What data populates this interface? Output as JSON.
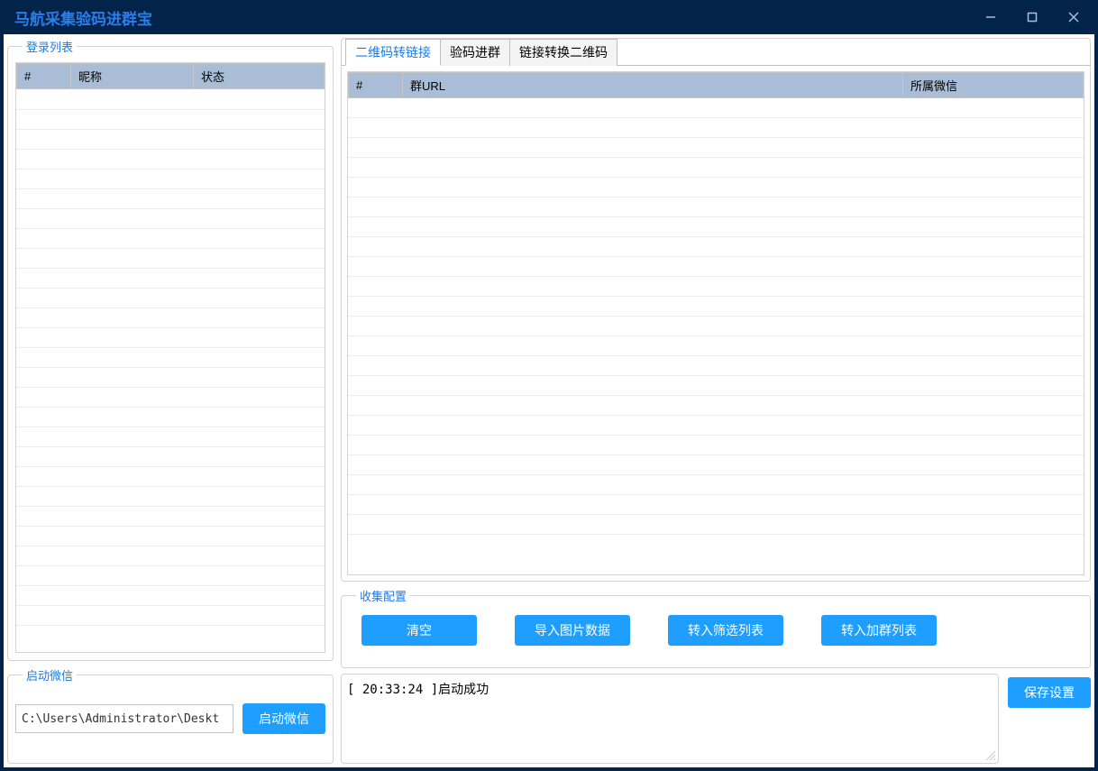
{
  "window": {
    "title": "马航采集验码进群宝"
  },
  "left": {
    "login_list_title": "登录列表",
    "login_cols": {
      "num": "#",
      "nick": "昵称",
      "status": "状态"
    },
    "start_wechat_title": "启动微信",
    "path_value": "C:\\Users\\Administrator\\Deskt",
    "start_button": "启动微信"
  },
  "tabs": {
    "items": [
      "二维码转链接",
      "验码进群",
      "链接转换二维码"
    ],
    "active_index": 0,
    "table_cols": {
      "num": "#",
      "url": "群URL",
      "wx": "所属微信"
    }
  },
  "collect": {
    "title": "收集配置",
    "buttons": {
      "clear": "清空",
      "import_images": "导入图片数据",
      "to_filter_list": "转入筛选列表",
      "to_join_list": "转入加群列表"
    }
  },
  "log": {
    "line1": "[ 20:33:24 ]启动成功"
  },
  "save_button": "保存设置"
}
